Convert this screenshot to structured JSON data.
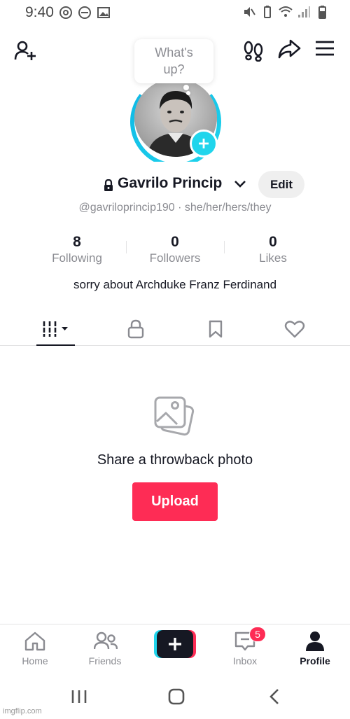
{
  "status_bar": {
    "time": "9:40",
    "left_icons": [
      "at-sign-icon",
      "do-not-disturb-icon",
      "image-icon"
    ],
    "right_icons": [
      "mute-icon",
      "battery-saver-icon",
      "wifi-icon",
      "signal-icon",
      "battery-icon"
    ]
  },
  "top_bar": {
    "add_friend_icon": "add-user-icon",
    "footprints_icon": "footprints-icon",
    "share_icon": "share-arrow-icon",
    "menu_icon": "hamburger-menu-icon"
  },
  "bubble": {
    "text": "What's up?"
  },
  "profile": {
    "name": "Gavrilo Princip",
    "handle": "@gavriloprincip190 · she/her/hers/they",
    "edit_label": "Edit",
    "bio": "sorry about Archduke Franz Ferdinand"
  },
  "stats": [
    {
      "value": "8",
      "label": "Following"
    },
    {
      "value": "0",
      "label": "Followers"
    },
    {
      "value": "0",
      "label": "Likes"
    }
  ],
  "tabs": [
    "videos-grid-icon",
    "lock-icon",
    "bookmark-icon",
    "heart-icon"
  ],
  "empty_state": {
    "title": "Share a throwback photo",
    "button_label": "Upload"
  },
  "bottom_nav": {
    "items": [
      {
        "label": "Home",
        "icon": "home-icon"
      },
      {
        "label": "Friends",
        "icon": "friends-icon"
      },
      {
        "label": "Inbox",
        "icon": "inbox-icon"
      },
      {
        "label": "Profile",
        "icon": "profile-icon"
      }
    ],
    "inbox_badge": "5"
  },
  "colors": {
    "accent_red": "#fe2c55",
    "accent_cyan": "#20d5ec",
    "text_primary": "#161823",
    "text_secondary": "#8a8b91"
  },
  "watermark": "imgflip.com"
}
